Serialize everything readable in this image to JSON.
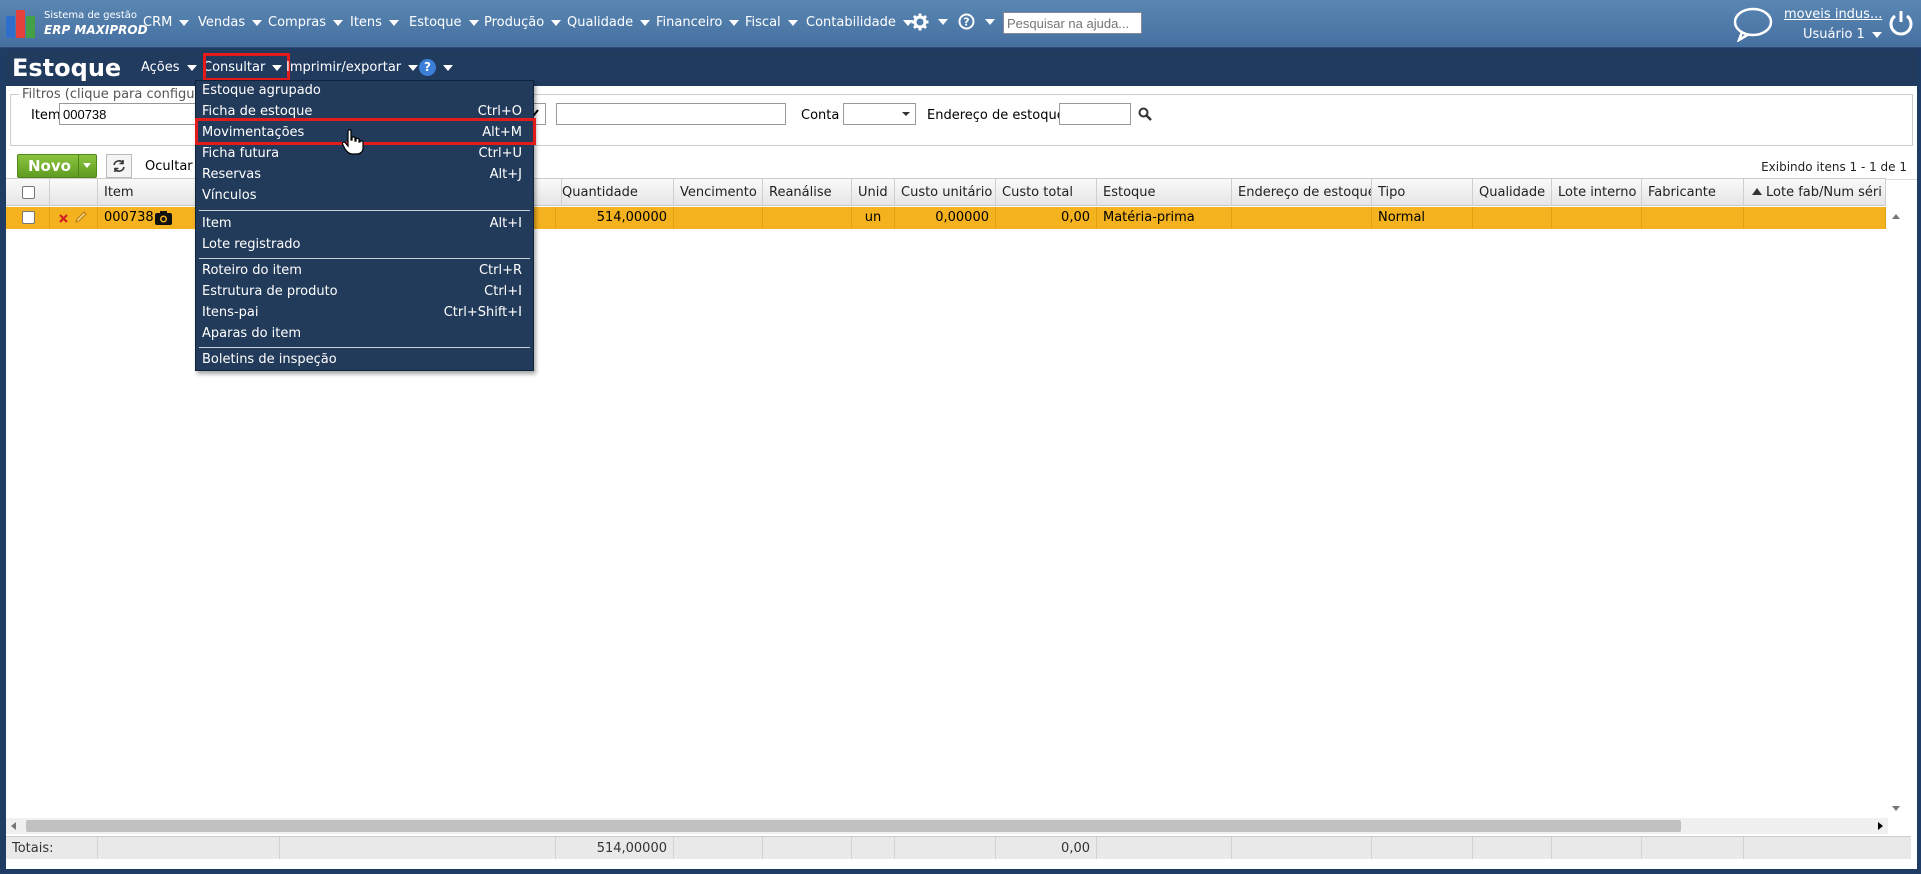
{
  "app": {
    "logo_line1": "Sistema de gestão",
    "logo_line2": "ERP MAXIPROD"
  },
  "topmenu": [
    "CRM",
    "Vendas",
    "Compras",
    "Itens",
    "Estoque",
    "Produção",
    "Qualidade",
    "Financeiro",
    "Fiscal",
    "Contabilidade"
  ],
  "search_help": {
    "placeholder": "Pesquisar na ajuda..."
  },
  "user": {
    "company": "moveis indus...",
    "name": "Usuário 1"
  },
  "title": "Estoque",
  "title_menus": {
    "acoes": "Ações",
    "consultar": "Consultar",
    "imprimir": "Imprimir/exportar",
    "help": "?"
  },
  "filters": {
    "legend": "Filtros (clique para configurar)",
    "item_label": "Item",
    "item_value": "000738",
    "conta_label": "Conta",
    "endereco_label": "Endereço de estoque"
  },
  "toolbar": {
    "novo": "Novo",
    "ocultar": "Ocultar t",
    "exibindo": "Exibindo itens 1 - 1 de 1"
  },
  "columns": [
    "Item",
    "Quantidade",
    "Vencimento",
    "Reanálise",
    "Unid",
    "Custo unitário",
    "Custo total",
    "Estoque",
    "Endereço de estoque",
    "Tipo",
    "Qualidade",
    "Lote interno",
    "Fabricante",
    "Lote fab/Num séri"
  ],
  "row": {
    "item": "000738",
    "quantidade": "514,00000",
    "vencimento": "",
    "reanalise": "",
    "unid": "un",
    "custo_unitario": "0,00000",
    "custo_total": "0,00",
    "estoque": "Matéria-prima",
    "endereco": "",
    "tipo": "Normal"
  },
  "totals": {
    "label": "Totais:",
    "quantidade": "514,00000",
    "custo_total": "0,00"
  },
  "dropdown": {
    "items": [
      {
        "label": "Estoque agrupado",
        "shortcut": ""
      },
      {
        "label": "Ficha de estoque",
        "shortcut": "Ctrl+O"
      },
      {
        "label": "Movimentações",
        "shortcut": "Alt+M"
      },
      {
        "label": "Ficha futura",
        "shortcut": "Ctrl+U"
      },
      {
        "label": "Reservas",
        "shortcut": "Alt+J"
      },
      {
        "label": "Vínculos",
        "shortcut": ""
      },
      {
        "label": "Item",
        "shortcut": "Alt+I"
      },
      {
        "label": "Lote registrado",
        "shortcut": ""
      },
      {
        "label": "Roteiro do item",
        "shortcut": "Ctrl+R"
      },
      {
        "label": "Estrutura de produto",
        "shortcut": "Ctrl+I"
      },
      {
        "label": "Itens-pai",
        "shortcut": "Ctrl+Shift+I"
      },
      {
        "label": "Aparas do item",
        "shortcut": ""
      },
      {
        "label": "Boletins de inspeção",
        "shortcut": ""
      }
    ]
  },
  "colors": {
    "topbar": "#4f7bab",
    "titlebar": "#203b5e",
    "selected_row": "#f4b21f",
    "highlight": "#e41b1b",
    "novo_green": "#6fae2c"
  }
}
